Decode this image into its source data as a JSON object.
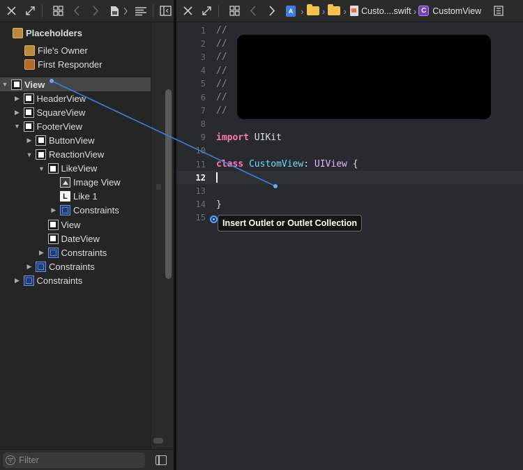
{
  "left_toolbar": {
    "icons": [
      "close-icon",
      "expand-arrows-icon",
      "grid-icon",
      "back-arrow-icon",
      "forward-arrow-icon",
      "document-icon",
      "chevron-right-icon",
      "list-lines-icon",
      "sidebar-toggle-icon"
    ]
  },
  "outline": {
    "placeholders_header": "Placeholders",
    "files_owner": "File's Owner",
    "first_responder": "First Responder",
    "items": [
      {
        "label": "View",
        "depth": 0,
        "expanded": true,
        "selected": true,
        "icon": "view-icon"
      },
      {
        "label": "HeaderView",
        "depth": 1,
        "expanded": false,
        "icon": "view-icon"
      },
      {
        "label": "SquareView",
        "depth": 1,
        "expanded": false,
        "icon": "view-icon"
      },
      {
        "label": "FooterView",
        "depth": 1,
        "expanded": true,
        "icon": "view-icon"
      },
      {
        "label": "ButtonView",
        "depth": 2,
        "expanded": false,
        "icon": "view-icon"
      },
      {
        "label": "ReactionView",
        "depth": 2,
        "expanded": true,
        "icon": "view-icon"
      },
      {
        "label": "LikeView",
        "depth": 3,
        "expanded": true,
        "icon": "view-icon"
      },
      {
        "label": "Image View",
        "depth": 4,
        "icon": "image-view-icon"
      },
      {
        "label": "Like 1",
        "depth": 4,
        "icon": "label-icon",
        "icon_glyph": "L"
      },
      {
        "label": "Constraints",
        "depth": 4,
        "expanded": false,
        "icon": "constraints-icon"
      },
      {
        "label": "View",
        "depth": 3,
        "icon": "view-icon"
      },
      {
        "label": "DateView",
        "depth": 3,
        "icon": "view-icon"
      },
      {
        "label": "Constraints",
        "depth": 3,
        "expanded": false,
        "icon": "constraints-icon"
      },
      {
        "label": "Constraints",
        "depth": 2,
        "expanded": false,
        "icon": "constraints-icon"
      },
      {
        "label": "Constraints",
        "depth": 1,
        "expanded": false,
        "icon": "constraints-icon"
      }
    ]
  },
  "filter": {
    "placeholder": "Filter"
  },
  "right_toolbar": {
    "file_name": "Custo....swift",
    "class_badge": "C",
    "symbol_name": "CustomView",
    "project_badge": "A"
  },
  "editor": {
    "current_line": 12,
    "lines": [
      {
        "num": "1",
        "text": "//"
      },
      {
        "num": "2",
        "text": "//"
      },
      {
        "num": "3",
        "text": "//"
      },
      {
        "num": "4",
        "text": "//"
      },
      {
        "num": "5",
        "text": "//"
      },
      {
        "num": "6",
        "text": "//"
      },
      {
        "num": "7",
        "text": "//"
      },
      {
        "num": "8",
        "text": ""
      },
      {
        "num": "9",
        "text": "import UIKit"
      },
      {
        "num": "10",
        "text": ""
      },
      {
        "num": "11",
        "text": "class CustomView: UIView {"
      },
      {
        "num": "12",
        "text": ""
      },
      {
        "num": "13",
        "text": ""
      },
      {
        "num": "14",
        "text": "}"
      },
      {
        "num": "15",
        "text": ""
      }
    ],
    "import_kw": "import",
    "import_module": "UIKit",
    "class_kw": "class",
    "class_name": "CustomView",
    "class_colon": ":",
    "superclass": "UIView",
    "open_brace": "{",
    "close_brace": "}",
    "comment": "//"
  },
  "tooltip": {
    "text": "Insert Outlet or Outlet Collection"
  },
  "colors": {
    "accent_link": "#3d7fd6",
    "keyword": "#ff7ab2",
    "type": "#dabaff",
    "comment": "#7f8c98"
  }
}
